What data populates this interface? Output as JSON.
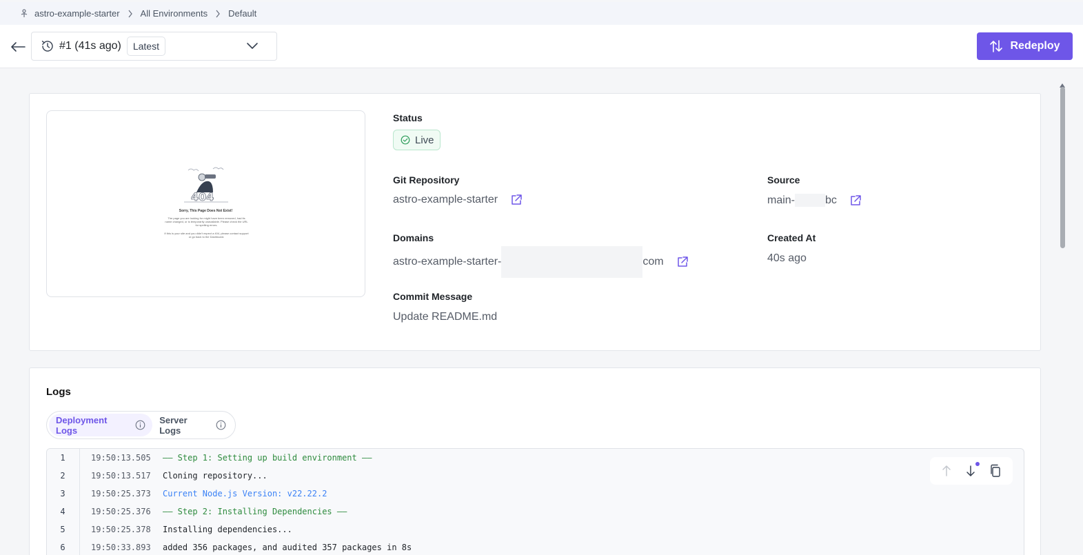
{
  "breadcrumb": {
    "items": [
      "astro-example-starter",
      "All Environments",
      "Default"
    ]
  },
  "header": {
    "deployment_label": "#1 (41s ago)",
    "latest_badge": "Latest",
    "redeploy_label": "Redeploy"
  },
  "preview": {
    "title": "Sorry, This Page Does Not Exist!",
    "body": "The page you are looking for might have been removed, had its name changed, or is temporarily unavailable. Please check the URL for spelling errors.",
    "body2": "If this is your site and you didn't expect a 404, please contact support or go back to the Dashboard."
  },
  "info": {
    "status_label": "Status",
    "status_value": "Live",
    "git_repo_label": "Git Repository",
    "git_repo_value": "astro-example-starter",
    "source_label": "Source",
    "source_prefix": "main-",
    "source_suffix": "bc",
    "domains_label": "Domains",
    "domain_prefix": "astro-example-starter-",
    "domain_suffix": "com",
    "created_label": "Created At",
    "created_value": "40s ago",
    "commit_label": "Commit Message",
    "commit_value": "Update README.md"
  },
  "logs": {
    "title": "Logs",
    "tabs": [
      "Deployment Logs",
      "Server Logs"
    ],
    "active_tab": "Deployment Logs",
    "lines": [
      {
        "n": "1",
        "ts": "19:50:13.505",
        "msg": "—— Step 1: Setting up build environment ——",
        "kind": "green"
      },
      {
        "n": "2",
        "ts": "19:50:13.517",
        "msg": "Cloning repository...",
        "kind": "plain"
      },
      {
        "n": "3",
        "ts": "19:50:25.373",
        "msg": "Current Node.js Version: v22.22.2",
        "kind": "blue"
      },
      {
        "n": "4",
        "ts": "19:50:25.376",
        "msg": "—— Step 2: Installing Dependencies ——",
        "kind": "green"
      },
      {
        "n": "5",
        "ts": "19:50:25.378",
        "msg": "Installing dependencies...",
        "kind": "plain"
      },
      {
        "n": "6",
        "ts": "19:50:33.893",
        "msg": "added 356 packages, and audited 357 packages in 8s",
        "kind": "plain"
      }
    ]
  },
  "colors": {
    "accent": "#6e56e8",
    "live_green": "#2e9d5b",
    "log_green": "#2e8b3e",
    "log_blue": "#3b82f6"
  }
}
